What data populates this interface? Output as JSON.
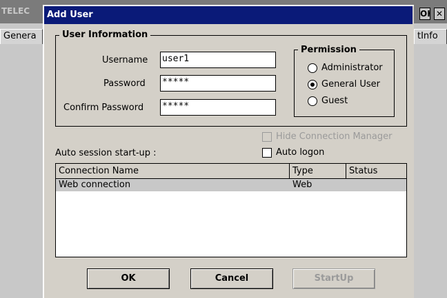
{
  "background_window": {
    "title": "TELEC",
    "ok_label": "OK",
    "close_label": "✕",
    "tab_left": "Genera",
    "tab_right": "tInfo"
  },
  "dialog": {
    "title": "Add User",
    "user_info": {
      "legend": "User Information",
      "username_label": "Username",
      "username_value": "user1",
      "password_label": "Password",
      "password_value": "*****",
      "confirm_label": "Confirm Password",
      "confirm_value": "*****"
    },
    "permission": {
      "legend": "Permission",
      "options": [
        "Administrator",
        "General User",
        "Guest"
      ],
      "selected": "General User"
    },
    "hide_connection_manager": "Hide Connection Manager",
    "auto_session_label": "Auto session start-up :",
    "auto_logon": "Auto logon",
    "connections": {
      "columns": [
        "Connection Name",
        "Type",
        "Status"
      ],
      "rows": [
        {
          "name": "Web connection",
          "type": "Web",
          "status": ""
        }
      ]
    },
    "buttons": {
      "ok": "OK",
      "cancel": "Cancel",
      "startup": "StartUp"
    }
  }
}
